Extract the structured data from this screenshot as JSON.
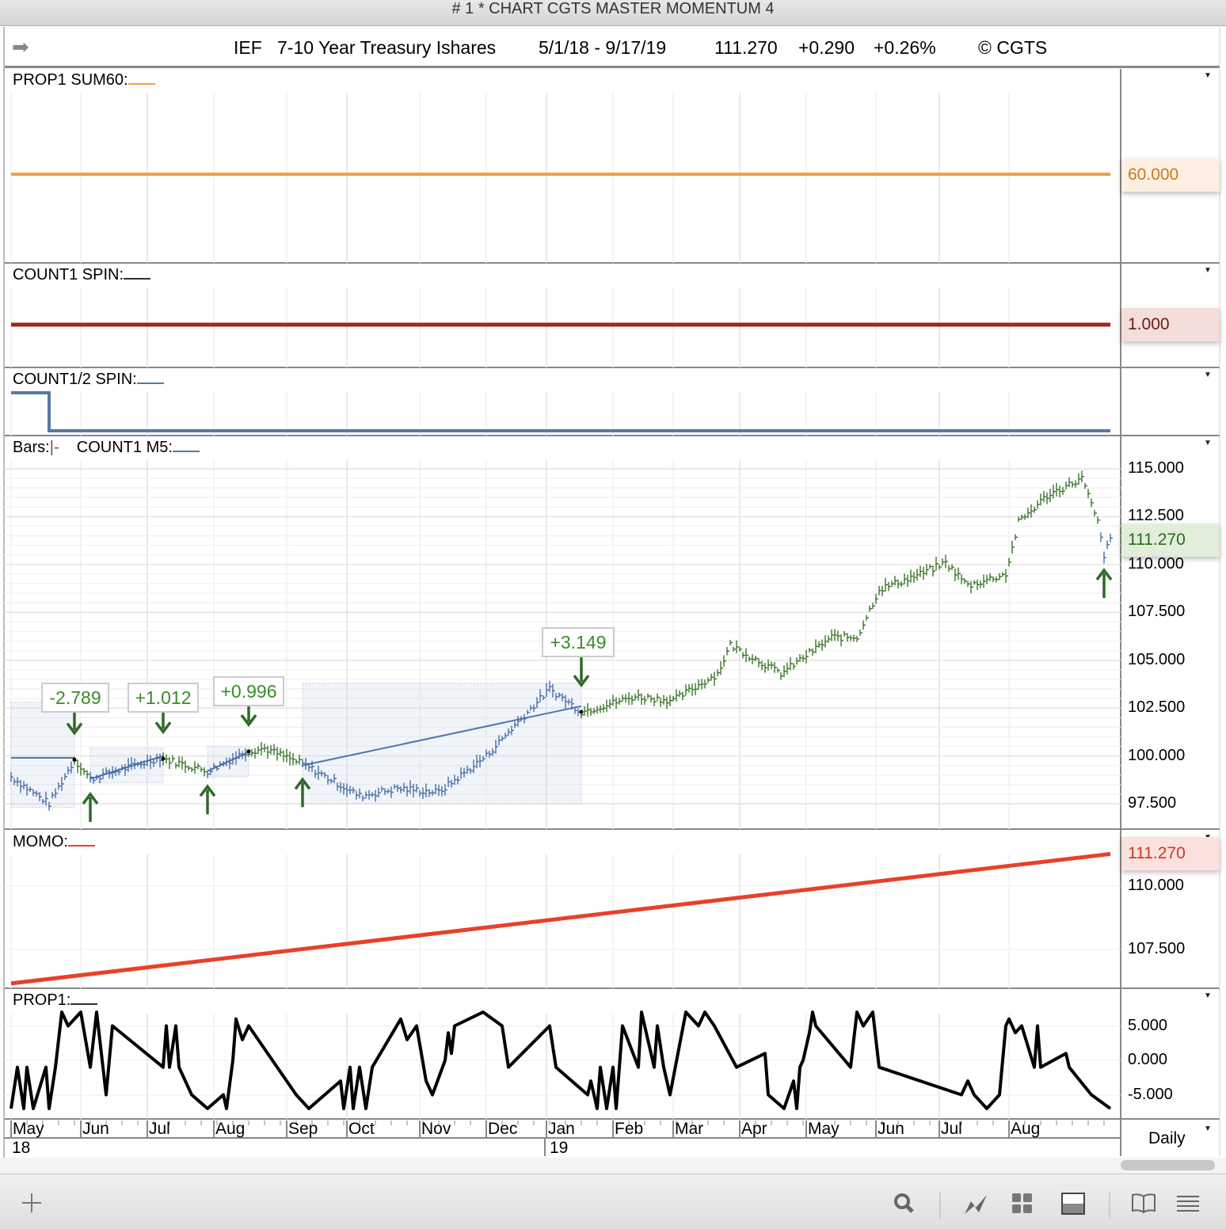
{
  "window": {
    "title": "# 1 * CHART CGTS MASTER MOMENTUM 4"
  },
  "header": {
    "symbol": "IEF",
    "name": "7-10 Year Treasury Ishares",
    "range": "5/1/18 - 9/17/19",
    "last": "111.270",
    "change": "+0.290",
    "change_pct": "+0.26%",
    "copyright": "© CGTS",
    "nav_icon": "arrow-right-icon"
  },
  "panels": {
    "p1": {
      "label": "PROP1 SUM60:",
      "value": "60.000",
      "color": "#f0a040"
    },
    "p2": {
      "label": "COUNT1 SPIN:",
      "value": "1.000",
      "color": "#9a2a1a"
    },
    "p3": {
      "label": "COUNT1/2 SPIN:",
      "color": "#5878a0"
    },
    "p4": {
      "label_bars": "Bars:",
      "bars_sym": "|-",
      "label": "COUNT1 M5:",
      "value": "111.270",
      "ticks": [
        "115.000",
        "112.500",
        "110.000",
        "107.500",
        "105.000",
        "102.500",
        "100.000",
        "97.500"
      ]
    },
    "p5": {
      "label": "MOMO:",
      "value": "111.270",
      "ticks": [
        "110.000",
        "107.500"
      ],
      "color": "#e8402a"
    },
    "p6": {
      "label": "PROP1:",
      "ticks": [
        "5.000",
        "0.000",
        "-5.000"
      ]
    }
  },
  "annotations": [
    "-2.789",
    "+1.012",
    "+0.996",
    "+3.149"
  ],
  "xaxis": {
    "months": [
      "May",
      "Jun",
      "Jul",
      "Aug",
      "Sep",
      "Oct",
      "Nov",
      "Dec",
      "Jan",
      "Feb",
      "Mar",
      "Apr",
      "May",
      "Jun",
      "Jul",
      "Aug"
    ],
    "years": [
      "18",
      "19"
    ],
    "interval": "Daily"
  },
  "toolbar": {
    "icons": [
      "plus-icon",
      "search-icon",
      "chart-line-icon",
      "grid-icon",
      "panel-icon",
      "book-icon",
      "menu-icon"
    ]
  },
  "chart_data": {
    "type": "line",
    "x_unit": "bar index (trading days from 5/1/18)",
    "month_ticks": [
      0,
      22,
      43,
      64,
      87,
      106,
      129,
      150,
      169,
      190,
      209,
      230,
      251,
      273,
      293,
      315
    ],
    "price": {
      "name": "IEF",
      "ylim": [
        96.5,
        116
      ],
      "points": [
        [
          0,
          98.9
        ],
        [
          12,
          97.5
        ],
        [
          20,
          99.8
        ],
        [
          25,
          98.8
        ],
        [
          47,
          99.9
        ],
        [
          62,
          99.2
        ],
        [
          74,
          100.2
        ],
        [
          80,
          100.4
        ],
        [
          93,
          99.5
        ],
        [
          110,
          97.9
        ],
        [
          122,
          98.3
        ],
        [
          135,
          98.1
        ],
        [
          150,
          100
        ],
        [
          159,
          101.6
        ],
        [
          170,
          103.5
        ],
        [
          180,
          102.3
        ],
        [
          197,
          103.1
        ],
        [
          209,
          102.9
        ],
        [
          223,
          104.3
        ],
        [
          227,
          105.8
        ],
        [
          243,
          104.3
        ],
        [
          259,
          106.2
        ],
        [
          267,
          106.2
        ],
        [
          274,
          108.7
        ],
        [
          287,
          109.5
        ],
        [
          295,
          110.1
        ],
        [
          302,
          108.9
        ],
        [
          314,
          109.5
        ],
        [
          318,
          112.2
        ],
        [
          327,
          113.6
        ],
        [
          338,
          114.5
        ],
        [
          343,
          112.2
        ],
        [
          345,
          110.5
        ],
        [
          347,
          111.27
        ]
      ],
      "regression_boxes": [
        {
          "from": 0,
          "to": 19,
          "low": 97.3,
          "high": 102.8,
          "start": 99.9,
          "end": 99.9
        },
        {
          "from": 25,
          "to": 47,
          "low": 98.6,
          "high": 100.4,
          "start": 98.8,
          "end": 100.0
        },
        {
          "from": 62,
          "to": 74,
          "low": 98.9,
          "high": 100.5,
          "start": 99.2,
          "end": 100.2
        },
        {
          "from": 92,
          "to": 179,
          "low": 97.5,
          "high": 103.8,
          "start": 99.5,
          "end": 102.6
        }
      ],
      "down_arrows": [
        20,
        48,
        75,
        180
      ],
      "up_arrows": [
        25,
        62,
        92,
        345
      ]
    },
    "sum60": 60,
    "spin": 1,
    "spin_half": {
      "points": [
        [
          0,
          1
        ],
        [
          12,
          1
        ],
        [
          12,
          0
        ],
        [
          347,
          0
        ]
      ]
    },
    "momo": {
      "start": 106.16,
      "end": 111.27,
      "ylim": [
        106,
        111.7
      ]
    },
    "prop1": {
      "ylim": [
        -8,
        8
      ],
      "points": [
        [
          0,
          -7
        ],
        [
          2,
          -1
        ],
        [
          4,
          -7
        ],
        [
          5,
          -1
        ],
        [
          7,
          -7
        ],
        [
          11,
          -1
        ],
        [
          12,
          -7
        ],
        [
          14,
          -1
        ],
        [
          16,
          7
        ],
        [
          18,
          5
        ],
        [
          22,
          7
        ],
        [
          25,
          -1
        ],
        [
          27,
          7
        ],
        [
          30,
          -5
        ],
        [
          32,
          5
        ],
        [
          48,
          -1
        ],
        [
          49,
          5
        ],
        [
          50,
          -1
        ],
        [
          52,
          5
        ],
        [
          53,
          -1
        ],
        [
          57,
          -5
        ],
        [
          62,
          -7
        ],
        [
          67,
          -5
        ],
        [
          68,
          -7
        ],
        [
          70,
          0
        ],
        [
          71,
          6
        ],
        [
          73,
          3
        ],
        [
          75,
          5
        ],
        [
          84,
          -1
        ],
        [
          90,
          -5
        ],
        [
          94,
          -7
        ],
        [
          104,
          -3
        ],
        [
          105,
          -7
        ],
        [
          107,
          -1
        ],
        [
          108,
          -7
        ],
        [
          110,
          -1
        ],
        [
          112,
          -7
        ],
        [
          114,
          -1
        ],
        [
          123,
          6
        ],
        [
          125,
          3
        ],
        [
          128,
          5
        ],
        [
          131,
          -3
        ],
        [
          133,
          -5
        ],
        [
          137,
          0
        ],
        [
          138,
          4
        ],
        [
          139,
          1
        ],
        [
          140,
          5
        ],
        [
          149,
          7
        ],
        [
          155,
          5
        ],
        [
          157,
          -1
        ],
        [
          170,
          5
        ],
        [
          172,
          -1
        ],
        [
          182,
          -5
        ],
        [
          183,
          -3
        ],
        [
          185,
          -7
        ],
        [
          186,
          -1
        ],
        [
          188,
          -7
        ],
        [
          190,
          -1
        ],
        [
          191,
          -7
        ],
        [
          193,
          5
        ],
        [
          198,
          -1
        ],
        [
          199,
          7
        ],
        [
          203,
          -1
        ],
        [
          204,
          5
        ],
        [
          206,
          -1
        ],
        [
          208,
          -5
        ],
        [
          213,
          7
        ],
        [
          217,
          5
        ],
        [
          219,
          7
        ],
        [
          222,
          5
        ],
        [
          229,
          -1
        ],
        [
          238,
          1
        ],
        [
          239,
          -5
        ],
        [
          244,
          -7
        ],
        [
          247,
          -3
        ],
        [
          248,
          -7
        ],
        [
          249,
          -1
        ],
        [
          250,
          0
        ],
        [
          252,
          4
        ],
        [
          253,
          7
        ],
        [
          254,
          5
        ],
        [
          265,
          -1
        ],
        [
          267,
          7
        ],
        [
          269,
          5
        ],
        [
          272,
          7
        ],
        [
          274,
          -1
        ],
        [
          300,
          -5
        ],
        [
          302,
          -3
        ],
        [
          304,
          -5
        ],
        [
          308,
          -7
        ],
        [
          312,
          -5
        ],
        [
          314,
          5
        ],
        [
          315,
          6
        ],
        [
          317,
          4
        ],
        [
          319,
          5
        ],
        [
          323,
          -1
        ],
        [
          324,
          5
        ],
        [
          325,
          -1
        ],
        [
          333,
          1
        ],
        [
          334,
          -1
        ],
        [
          341,
          -5
        ],
        [
          347,
          -7
        ]
      ]
    }
  }
}
